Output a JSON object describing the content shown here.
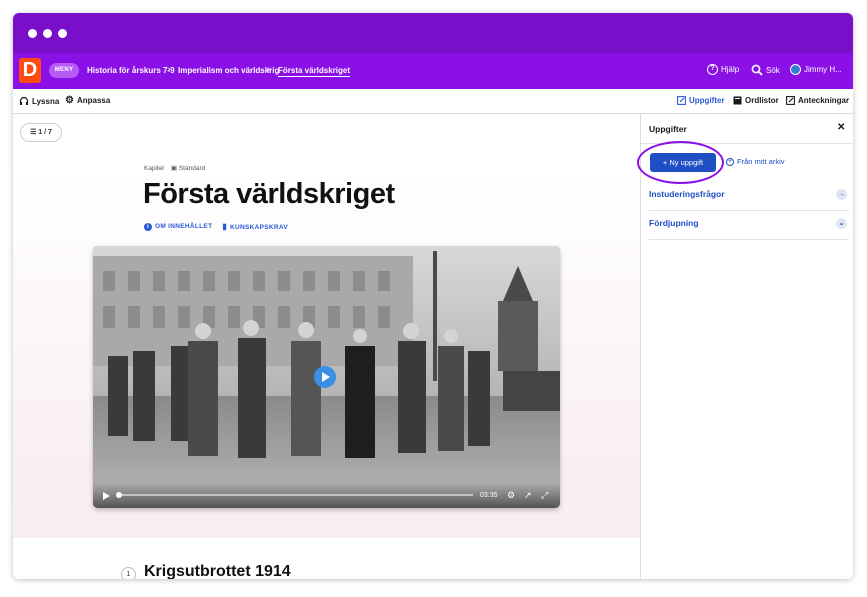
{
  "navbar": {
    "logo_letter": "D",
    "menu_label": "MENY",
    "breadcrumbs": [
      "Historia för årskurs 7-9",
      "Imperialism och världskrig",
      "Första världskriget"
    ],
    "help_label": "Hjälp",
    "search_label": "Sök",
    "user_label": "Jimmy H..."
  },
  "toolbar": {
    "listen_label": "Lyssna",
    "adjust_label": "Anpassa",
    "tasks_label": "Uppgifter",
    "wordlists_label": "Ordlistor",
    "notes_label": "Anteckningar"
  },
  "main": {
    "pager": "1 / 7",
    "meta_type": "Kapitel",
    "meta_level": "Standard",
    "title": "Första världskriget",
    "about_label": "OM INNEHÅLLET",
    "requirements_label": "KUNSKAPSKRAV",
    "video_duration": "03:35",
    "video_progress": 0.0,
    "section_number": "1",
    "section_title": "Krigsutbrottet 1914"
  },
  "sidebar": {
    "title": "Uppgifter",
    "new_task_label": "Ny uppgift",
    "from_archive_label": "Från mitt arkiv",
    "rows": [
      {
        "label": "Instuderingsfrågor",
        "icon": "arrow-right-icon"
      },
      {
        "label": "Fördjupning",
        "icon": "chevron-down-icon"
      }
    ]
  },
  "colors": {
    "titlebar": "#7a0fc9",
    "navbar": "#8b10e6",
    "logo": "#ff4a14",
    "accent_blue": "#1f4fc4",
    "highlight_ring": "#8b10e6"
  }
}
